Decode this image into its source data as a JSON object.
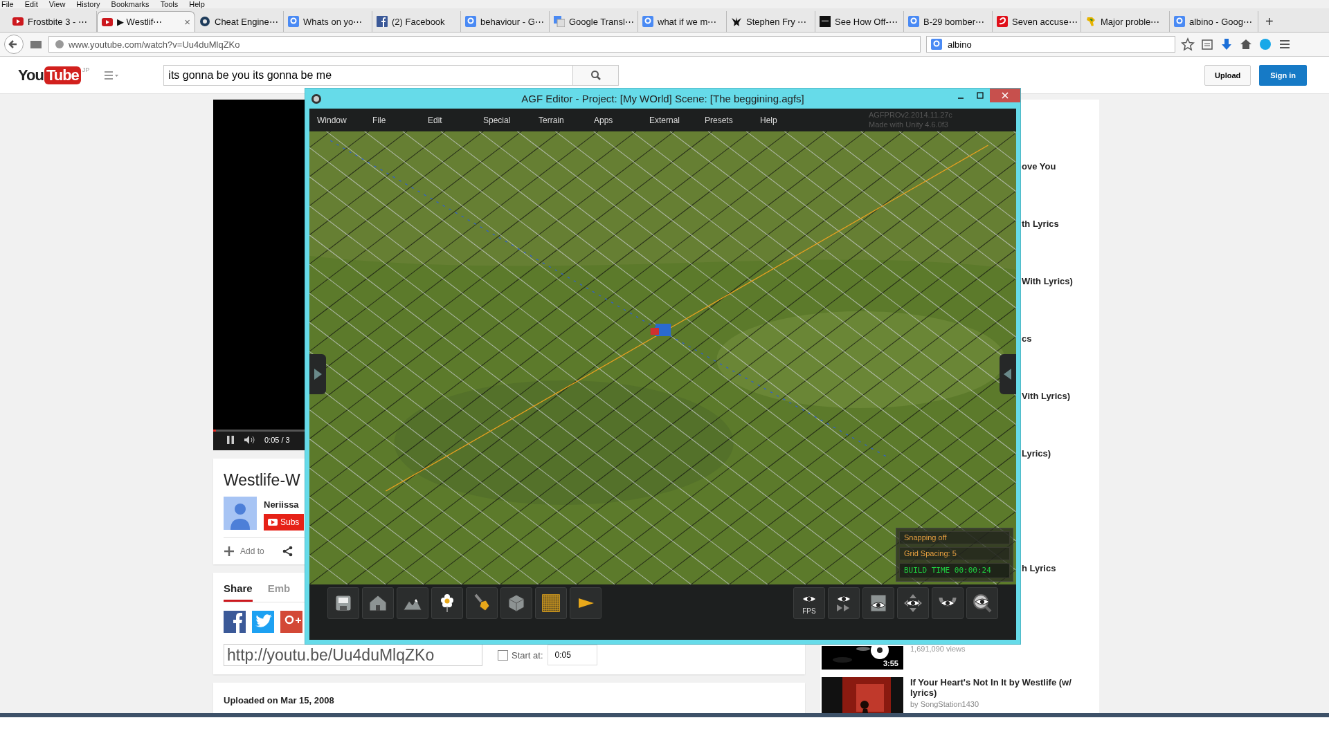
{
  "browser": {
    "menu": [
      "File",
      "Edit",
      "View",
      "History",
      "Bookmarks",
      "Tools",
      "Help"
    ],
    "tabs": [
      {
        "kind": "red-play",
        "title": "Frostbite 3 - ⋯",
        "selected": false
      },
      {
        "kind": "red-play",
        "title": "▶ Westlif⋯",
        "selected": true,
        "close": "×"
      },
      {
        "kind": "gear",
        "title": "Cheat Engine⋯",
        "selected": false
      },
      {
        "kind": "g-square",
        "title": "Whats on yo⋯",
        "selected": false
      },
      {
        "kind": "f-square",
        "title": "(2) Facebook",
        "selected": false
      },
      {
        "kind": "g-square",
        "title": "behaviour - G⋯",
        "selected": false
      },
      {
        "kind": "translate",
        "title": "Google Transl⋯",
        "selected": false
      },
      {
        "kind": "g-square",
        "title": "what if we m⋯",
        "selected": false
      },
      {
        "kind": "bird",
        "title": "Stephen Fry ⋯",
        "selected": false
      },
      {
        "kind": "dark-square",
        "title": "See How Off-⋯",
        "selected": false
      },
      {
        "kind": "g-square",
        "title": "B-29 bomber⋯",
        "selected": false
      },
      {
        "kind": "red-square",
        "title": "Seven accuse⋯",
        "selected": false
      },
      {
        "kind": "map",
        "title": "Major proble⋯",
        "selected": false
      },
      {
        "kind": "g-square",
        "title": "albino - Goog⋯",
        "selected": false
      }
    ],
    "new_tab": "+",
    "address": "www.youtube.com/watch?v=Uu4duMlqZKo",
    "search": "albino"
  },
  "youtube": {
    "logo": {
      "left": "You",
      "right": "Tube",
      "region": "JP"
    },
    "search": {
      "value": "its gonna be you its gonna be me"
    },
    "upload": "Upload",
    "sign_in": "Sign in",
    "player": {
      "time": "0:05 / 3",
      "level": 0.03
    },
    "video": {
      "title": "Westlife-W",
      "channel": "Neriissa",
      "subscribe": "Subs",
      "add_to": "Add to"
    },
    "share": {
      "tabs": [
        {
          "label": "Share",
          "selected": true
        },
        {
          "label": "Emb",
          "selected": false
        }
      ],
      "url": "http://youtu.be/Uu4duMlqZKo",
      "start_at": {
        "label": "Start at:",
        "checked": false,
        "value": "0:05"
      }
    },
    "uploaded": "Uploaded on Mar 15, 2008",
    "sidebar": {
      "items": [
        {
          "title": "ove You"
        },
        {
          "title": "th Lyrics"
        },
        {
          "title": "With Lyrics)"
        },
        {
          "title": "cs"
        },
        {
          "title": "Vith Lyrics)"
        },
        {
          "title": "Lyrics)"
        },
        {
          "title": "h Lyrics"
        }
      ],
      "views": "1,691,090 views",
      "duration": "3:55",
      "next": {
        "title": "If Your Heart's Not In It by Westlife (w/ lyrics)",
        "channel": "by SongStation1430"
      }
    }
  },
  "editor": {
    "title": "AGF Editor - Project: [My WOrld] Scene: [The beggining.agfs]",
    "menu": [
      "Window",
      "File",
      "Edit",
      "Special",
      "Terrain",
      "Apps",
      "External",
      "Presets",
      "Help"
    ],
    "version": [
      "AGFPROv2.2014.11.27c",
      "Made with Unity 4.6.0f3"
    ],
    "status": [
      "Snapping off",
      "Grid Spacing: 5"
    ],
    "build_time": "BUILD TIME 00:00:24",
    "tools": [
      {
        "kind": "save"
      },
      {
        "kind": "house"
      },
      {
        "kind": "mountain"
      },
      {
        "kind": "flower"
      },
      {
        "kind": "brush"
      },
      {
        "kind": "cube"
      },
      {
        "kind": "grid"
      },
      {
        "kind": "play"
      }
    ],
    "view_tools": [
      {
        "kind": "fps",
        "label": "FPS"
      },
      {
        "kind": "eye-forward"
      },
      {
        "kind": "eye-card"
      },
      {
        "kind": "eye-move"
      },
      {
        "kind": "eye-magnet"
      },
      {
        "kind": "eye-zoom"
      }
    ]
  }
}
